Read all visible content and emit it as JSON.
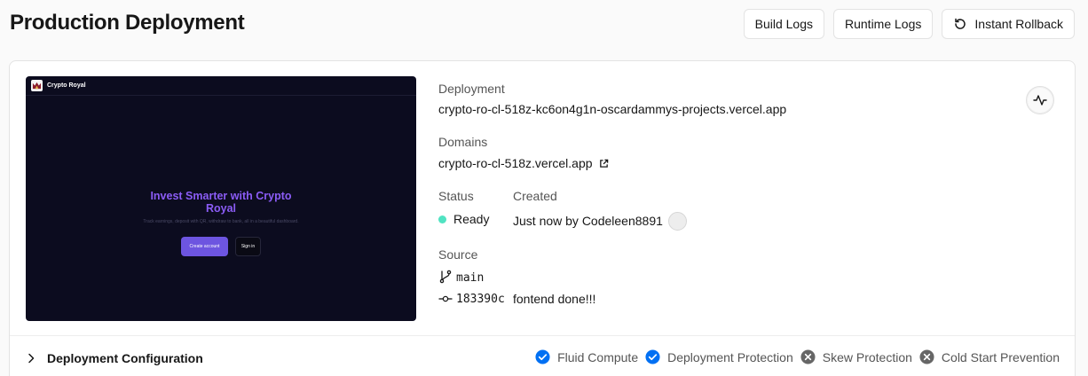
{
  "header": {
    "title": "Production Deployment",
    "actions": {
      "build_logs": "Build Logs",
      "runtime_logs": "Runtime Logs",
      "instant_rollback": "Instant Rollback"
    }
  },
  "preview": {
    "brand": "Crypto Royal",
    "hero_title": "Invest Smarter with Crypto Royal",
    "hero_subtitle": "Track earnings, deposit with QR, withdraw to bank, all in a beautiful dashboard.",
    "primary_button": "Create account",
    "secondary_button": "Sign in"
  },
  "deployment": {
    "deployment_label": "Deployment",
    "deployment_url": "crypto-ro-cl-518z-kc6on4g1n-oscardammys-projects.vercel.app",
    "domains_label": "Domains",
    "domain": "crypto-ro-cl-518z.vercel.app",
    "status_label": "Status",
    "status": "Ready",
    "created_label": "Created",
    "created": "Just now by Codeleen8891",
    "source_label": "Source",
    "branch": "main",
    "commit_sha": "183390c",
    "commit_message": "fontend done!!!"
  },
  "config": {
    "title": "Deployment Configuration",
    "features": [
      {
        "label": "Fluid Compute",
        "enabled": true
      },
      {
        "label": "Deployment Protection",
        "enabled": true
      },
      {
        "label": "Skew Protection",
        "enabled": false
      },
      {
        "label": "Cold Start Prevention",
        "enabled": false
      }
    ]
  },
  "colors": {
    "status_ready": "#50e3c2",
    "enabled": "#0070f3",
    "disabled": "#666666",
    "preview_accent": "#8b5cf6"
  },
  "icons": {
    "rollback": "rollback-icon",
    "activity": "activity-icon",
    "external": "external-link-icon",
    "branch": "git-branch-icon",
    "commit": "git-commit-icon",
    "chevron": "chevron-right-icon",
    "check": "check-circle-icon",
    "x": "x-circle-icon"
  }
}
